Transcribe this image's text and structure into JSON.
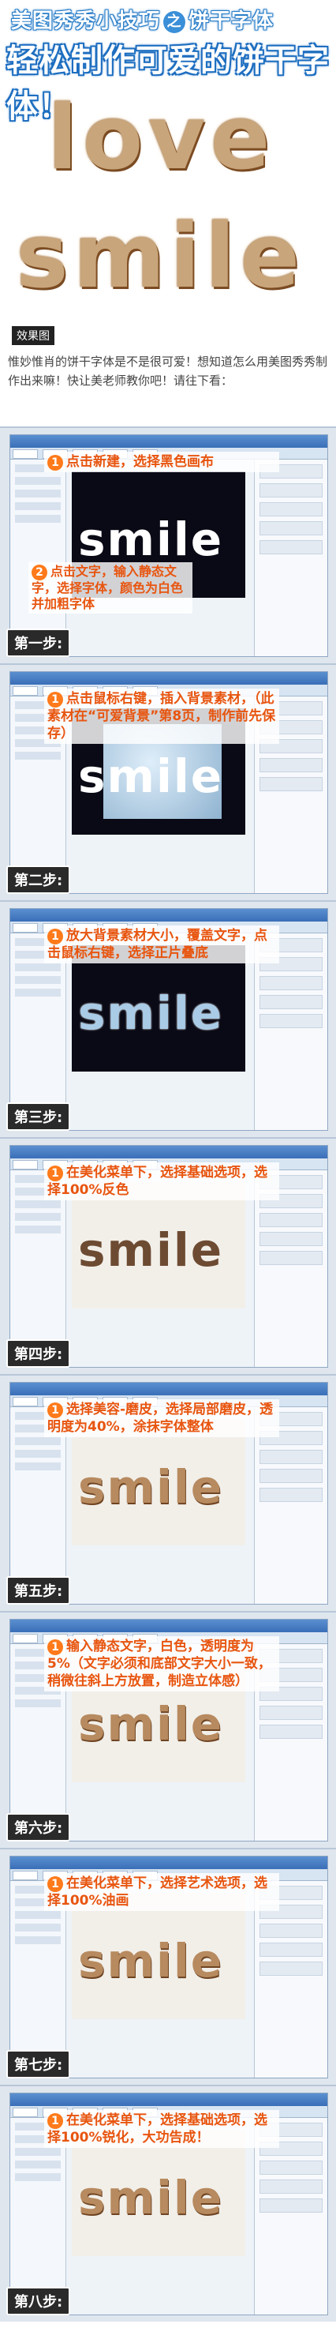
{
  "header": {
    "top_pre": "美图秀秀小技巧",
    "top_circle": "之",
    "top_post": "饼干字体",
    "main_title": "轻松制作可爱的饼干字体！",
    "word_love": "love",
    "word_smile": "smile",
    "effect_label": "效果图",
    "intro": "惟妙惟肖的饼干字体是不是很可爱！想知道怎么用美图秀秀制作出来嘛！快让美老师教你吧！请往下看："
  },
  "steps": [
    {
      "label": "第一步:",
      "callouts": [
        {
          "num": "1",
          "text": "点击新建，选择黑色画布"
        },
        {
          "num": "2",
          "text": "点击文字，输入静态文字，选择字体，颜色为白色并加粗字体"
        }
      ],
      "canvas_text": "smile"
    },
    {
      "label": "第二步:",
      "callouts": [
        {
          "num": "1",
          "text": "点击鼠标右键，插入背景素材，（此素材在“可爱背景”第8页，制作前先保存）"
        }
      ],
      "canvas_text": "smile"
    },
    {
      "label": "第三步:",
      "callouts": [
        {
          "num": "1",
          "text": "放大背景素材大小，覆盖文字，点击鼠标右键，选择正片叠底"
        }
      ],
      "canvas_text": "smile"
    },
    {
      "label": "第四步:",
      "callouts": [
        {
          "num": "1",
          "text": "在美化菜单下，选择基础选项，选择100%反色"
        }
      ],
      "canvas_text": "smile"
    },
    {
      "label": "第五步:",
      "callouts": [
        {
          "num": "1",
          "text": "选择美容-磨皮，选择局部磨皮，透明度为40%，涂抹字体整体"
        }
      ],
      "canvas_text": "smile"
    },
    {
      "label": "第六步:",
      "callouts": [
        {
          "num": "1",
          "text": "输入静态文字，白色，透明度为5%（文字必须和底部文字大小一致，稍微往斜上方放置，制造立体感）"
        }
      ],
      "canvas_text": "smile"
    },
    {
      "label": "第七步:",
      "callouts": [
        {
          "num": "1",
          "text": "在美化菜单下，选择艺术选项，选择100%油画"
        }
      ],
      "canvas_text": "smile"
    },
    {
      "label": "第八步:",
      "callouts": [
        {
          "num": "1",
          "text": "在美化菜单下，选择基础选项，选择100%锐化，大功告成！"
        }
      ],
      "canvas_text": "smile"
    }
  ],
  "colors": {
    "accent_orange": "#e8550f",
    "title_blue": "#1f6fc0",
    "cookie_brown": "#c9a57b"
  }
}
